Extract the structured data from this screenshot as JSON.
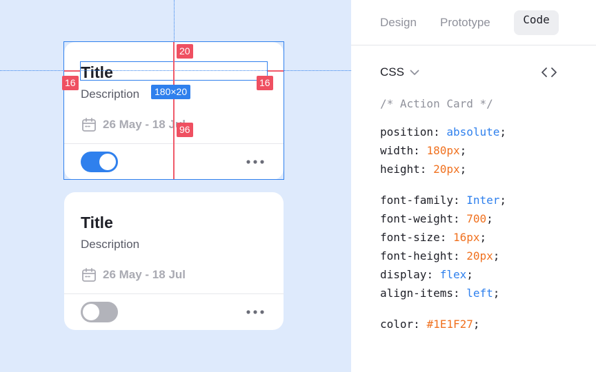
{
  "canvas": {
    "cards": [
      {
        "title": "Title",
        "description": "Description",
        "date": "26 May - 18 Jul",
        "toggle_on": true,
        "selected": true
      },
      {
        "title": "Title",
        "description": "Description",
        "date": "26 May - 18 Jul",
        "toggle_on": false,
        "selected": false
      }
    ],
    "measurements": {
      "top": "20",
      "left": "16",
      "right": "16",
      "size": "180×20",
      "bottom": "96"
    }
  },
  "inspector": {
    "tabs": [
      "Design",
      "Prototype",
      "Code"
    ],
    "active_tab": "Code",
    "language": "CSS",
    "comment": "/* Action Card */",
    "groups": [
      [
        {
          "prop": "position",
          "value": "absolute",
          "kind": "keyword"
        },
        {
          "prop": "width",
          "value": "180px",
          "kind": "number"
        },
        {
          "prop": "height",
          "value": "20px",
          "kind": "number"
        }
      ],
      [
        {
          "prop": "font-family",
          "value": "Inter",
          "kind": "keyword"
        },
        {
          "prop": "font-weight",
          "value": "700",
          "kind": "number"
        },
        {
          "prop": "font-size",
          "value": "16px",
          "kind": "number"
        },
        {
          "prop": "font-height",
          "value": "20px",
          "kind": "number"
        },
        {
          "prop": "display",
          "value": "flex",
          "kind": "keyword"
        },
        {
          "prop": "align-items",
          "value": "left",
          "kind": "keyword"
        }
      ],
      [
        {
          "prop": "color",
          "value": "#1E1F27",
          "kind": "number"
        }
      ]
    ]
  },
  "colors": {
    "canvas_bg": "#DEEAFC",
    "accent": "#2F80ED",
    "measure_red": "#EF5061",
    "text_primary": "#1E1F27",
    "code_value_number": "#F0711F"
  },
  "icons": {
    "calendar": "calendar-icon",
    "more": "more-horizontal-icon",
    "chevron": "chevron-down-icon",
    "embed": "code-brackets-icon"
  }
}
